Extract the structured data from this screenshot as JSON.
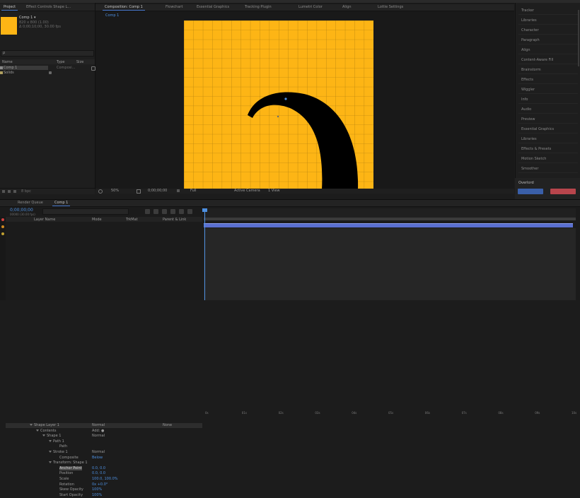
{
  "colors": {
    "accent": "#4d8fe0",
    "comp_bg": "#fdb515",
    "shape": "#000000",
    "panel": "#1c1c1c",
    "blue_button": "#3a5fa8",
    "red_button": "#b8454c"
  },
  "project": {
    "tab": "Project",
    "effect_controls_tab": "Effect Controls Shape L...",
    "selected_item": "Comp 1 ▾",
    "info_line1": "820 x 800 (1.00)",
    "info_line2": "Δ 0;00;10;00, 30.00 fps",
    "search_placeholder": "ρ",
    "col_name": "Name",
    "col_type": "Type",
    "col_size": "Size",
    "items": [
      {
        "name": "Comp 1",
        "type": "Composi...",
        "selected": true
      },
      {
        "name": "Solids",
        "type": "",
        "selected": false
      }
    ]
  },
  "viewer": {
    "tabs": [
      "Composition: Comp 1",
      "Flowchart",
      "Essential Graphics",
      "Tracking Plugin",
      "Lumetri Color",
      "Align",
      "Lottie Settings"
    ],
    "breadcrumb": "Comp 1",
    "zoom": "50%",
    "timecode": "0;00;00;00",
    "resolution": "Full",
    "camera": "Active Camera",
    "views": "1 View"
  },
  "effects_panel": {
    "items": [
      "Tracker",
      "Libraries",
      "Character",
      "Paragraph",
      "Align",
      "Content-Aware Fill",
      "Brainstorm",
      "Effects",
      "Wiggler",
      "Info",
      "Audio",
      "Preview",
      "Essential Graphics",
      "Libraries",
      "Effects & Presets",
      "Motion Sketch",
      "Smoother"
    ],
    "footer_title": "Overlord",
    "footer_blue_btn": "",
    "footer_red_btn": ""
  },
  "timeline": {
    "render_queue_tab": "Render Queue",
    "comp_tab": "Comp 1",
    "timecode": "0;00;00;00",
    "fps_note": "00000 (30.00 fps)",
    "col_layer": "Layer Name",
    "col_mode": "Mode",
    "col_trkmat": "TrkMat",
    "col_parent": "Parent & Link",
    "ruler": [
      "0s",
      "01s",
      "02s",
      "03s",
      "04s",
      "05s",
      "06s",
      "07s",
      "08s",
      "09s",
      "10s"
    ],
    "layers": [
      {
        "name": "Shape Layer 1",
        "mode": "Normal",
        "parent": "None",
        "indent": 0,
        "kind": "layer"
      },
      {
        "name": "Contents",
        "value": "Add: ●",
        "indent": 1,
        "kind": "group"
      },
      {
        "name": "Shape 1",
        "value": "Normal",
        "indent": 2,
        "kind": "group"
      },
      {
        "name": "Path 1",
        "value": "",
        "indent": 3,
        "kind": "group"
      },
      {
        "name": "Path",
        "value": "",
        "indent": 4,
        "kind": "prop",
        "highlight": false
      },
      {
        "name": "Stroke 1",
        "value": "Normal",
        "indent": 3,
        "kind": "group"
      },
      {
        "name": "Composite",
        "value": "Below",
        "indent": 4,
        "kind": "prop"
      },
      {
        "name": "Transform: Shape 1",
        "value": "",
        "indent": 3,
        "kind": "group"
      },
      {
        "name": "Anchor Point",
        "value": "0.0, 0.0",
        "indent": 4,
        "kind": "prop",
        "highlight": true
      },
      {
        "name": "Position",
        "value": "0.0, 0.0",
        "indent": 4,
        "kind": "prop"
      },
      {
        "name": "Scale",
        "value": "100.0, 100.0%",
        "indent": 4,
        "kind": "prop"
      },
      {
        "name": "Rotation",
        "value": "0x +0.0°",
        "indent": 4,
        "kind": "prop"
      },
      {
        "name": "Skew Opacity",
        "value": "100%",
        "indent": 4,
        "kind": "prop"
      },
      {
        "name": "Start Opacity",
        "value": "100%",
        "indent": 4,
        "kind": "prop"
      }
    ]
  }
}
